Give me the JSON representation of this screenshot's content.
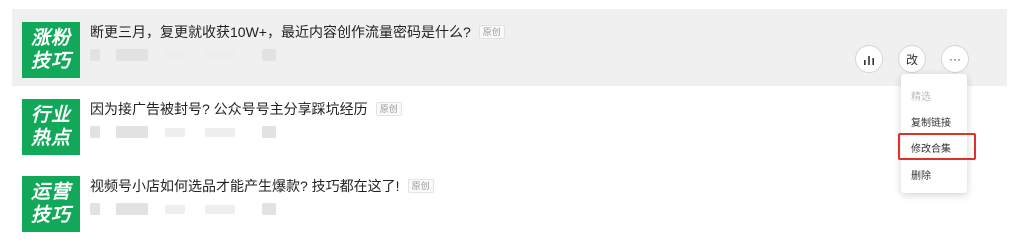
{
  "articles": [
    {
      "thumb_line1": "涨粉",
      "thumb_line2": "技巧",
      "title": "断更三月，复更就收获10W+，最近内容创作流量密码是什么?",
      "badge": "原创"
    },
    {
      "thumb_line1": "行业",
      "thumb_line2": "热点",
      "title": "因为接广告被封号? 公众号号主分享踩坑经历",
      "badge": "原创"
    },
    {
      "thumb_line1": "运营",
      "thumb_line2": "技巧",
      "title": "视频号小店如何选品才能产生爆款? 技巧都在这了!",
      "badge": "原创"
    }
  ],
  "actions": {
    "edit_label": "改",
    "more_label": "···",
    "stats_icon": "bar-chart-icon"
  },
  "menu": {
    "items": [
      "精选",
      "复制链接",
      "修改合集",
      "删除"
    ],
    "highlighted": "修改合集"
  },
  "colors": {
    "thumb_green": "#12a85a",
    "highlight_red": "#e0302a",
    "hover_row": "#f0f0f0"
  }
}
